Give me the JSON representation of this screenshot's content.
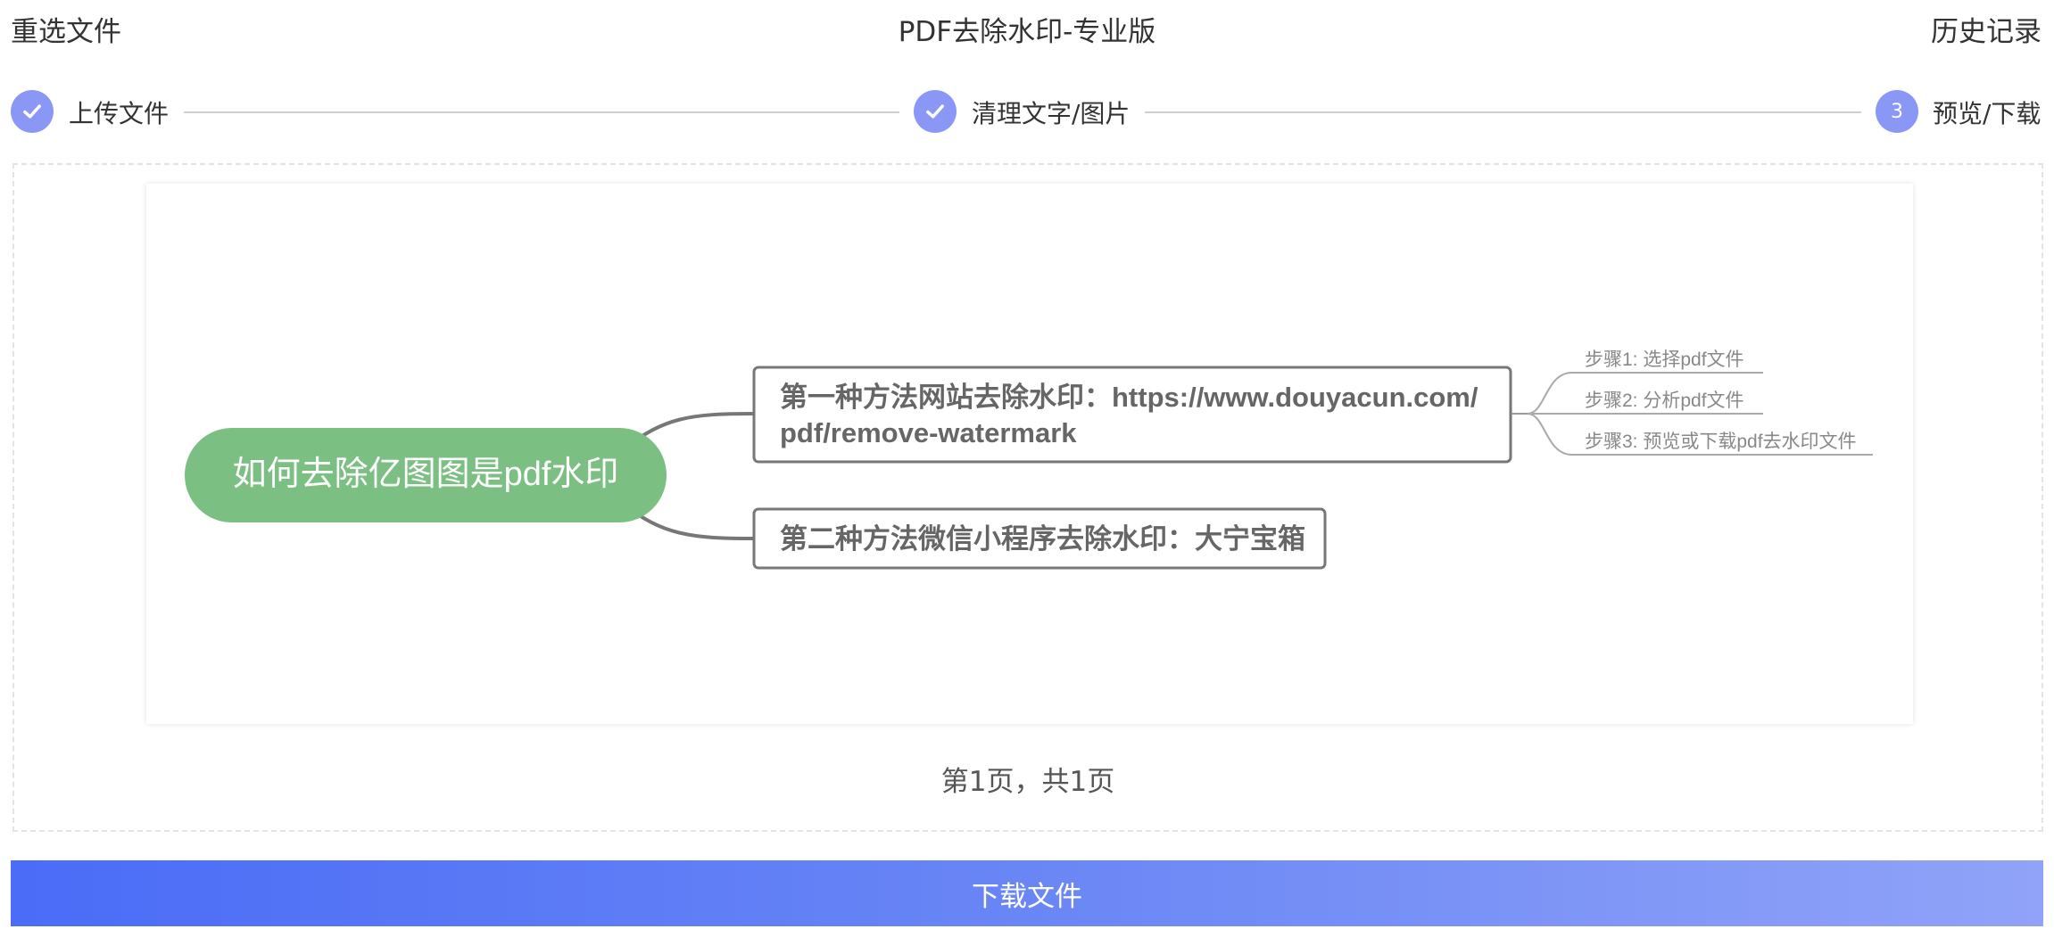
{
  "header": {
    "reselect_label": "重选文件",
    "title": "PDF去除水印-专业版",
    "history_label": "历史记录"
  },
  "steps": [
    {
      "label": "上传文件",
      "state": "done"
    },
    {
      "label": "清理文字/图片",
      "state": "done"
    },
    {
      "label": "预览/下载",
      "state": "current",
      "number": "3"
    }
  ],
  "mindmap": {
    "root": "如何去除亿图图是pdf水印",
    "method1_line1": "第一种方法网站去除水印：https://www.douyacun.com/",
    "method1_line2": "pdf/remove-watermark",
    "method2": "第二种方法微信小程序去除水印：大宁宝箱",
    "step1": "步骤1: 选择pdf文件",
    "step2": "步骤2: 分析pdf文件",
    "step3": "步骤3: 预览或下载pdf去水印文件"
  },
  "pagination": {
    "text": "第1页，共1页"
  },
  "download_label": "下载文件",
  "colors": {
    "accent": "#8b97f5",
    "root_node": "#7bbf83",
    "button_start": "#4a6cf7",
    "button_end": "#90a3f8"
  }
}
